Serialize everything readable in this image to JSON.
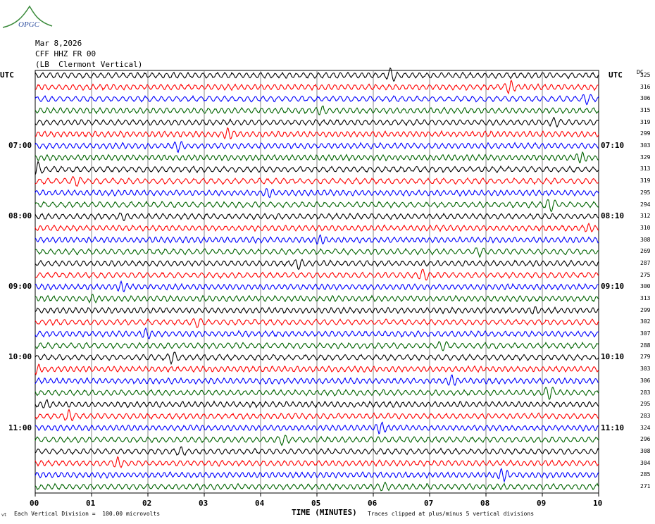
{
  "header": {
    "logo": "OPGC",
    "date": "Mar 8,2026",
    "station": "CFF HHZ FR 00",
    "location": "(LB  Clermont Vertical)"
  },
  "left_tz": "UTC",
  "right_tz": "UTC",
  "dc_label": "DC",
  "footer": {
    "corner": "vt",
    "scale": "Each Vertical Division =  100.00 microvolts",
    "xlabel": "TIME (MINUTES)",
    "clip": "Traces clipped at plus/minus 5 vertical divisions"
  },
  "chart_data": {
    "type": "line",
    "title": "Mar 8,2026 CFF HHZ FR 00 (LB Clermont Vertical)",
    "xlabel": "TIME (MINUTES)",
    "xlim": [
      0,
      10
    ],
    "x_ticks": [
      "00",
      "01",
      "02",
      "03",
      "04",
      "05",
      "06",
      "07",
      "08",
      "09",
      "10"
    ],
    "trace_colors": [
      "#000000",
      "#ff0000",
      "#0000ff",
      "#006400"
    ],
    "left_hour_labels": [
      {
        "trace": 6,
        "label": "07:00"
      },
      {
        "trace": 12,
        "label": "08:00"
      },
      {
        "trace": 18,
        "label": "09:00"
      },
      {
        "trace": 24,
        "label": "10:00"
      },
      {
        "trace": 30,
        "label": "11:00"
      }
    ],
    "right_hour_labels": [
      {
        "trace": 6,
        "label": "07:10"
      },
      {
        "trace": 12,
        "label": "08:10"
      },
      {
        "trace": 18,
        "label": "09:10"
      },
      {
        "trace": 24,
        "label": "10:10"
      },
      {
        "trace": 30,
        "label": "11:10"
      }
    ],
    "dc_offsets": [
      325,
      316,
      306,
      315,
      319,
      299,
      303,
      329,
      313,
      319,
      295,
      294,
      312,
      310,
      308,
      269,
      287,
      275,
      300,
      313,
      299,
      302,
      307,
      288,
      279,
      303,
      306,
      283,
      295,
      283,
      324,
      296,
      308,
      304,
      285,
      271
    ]
  }
}
